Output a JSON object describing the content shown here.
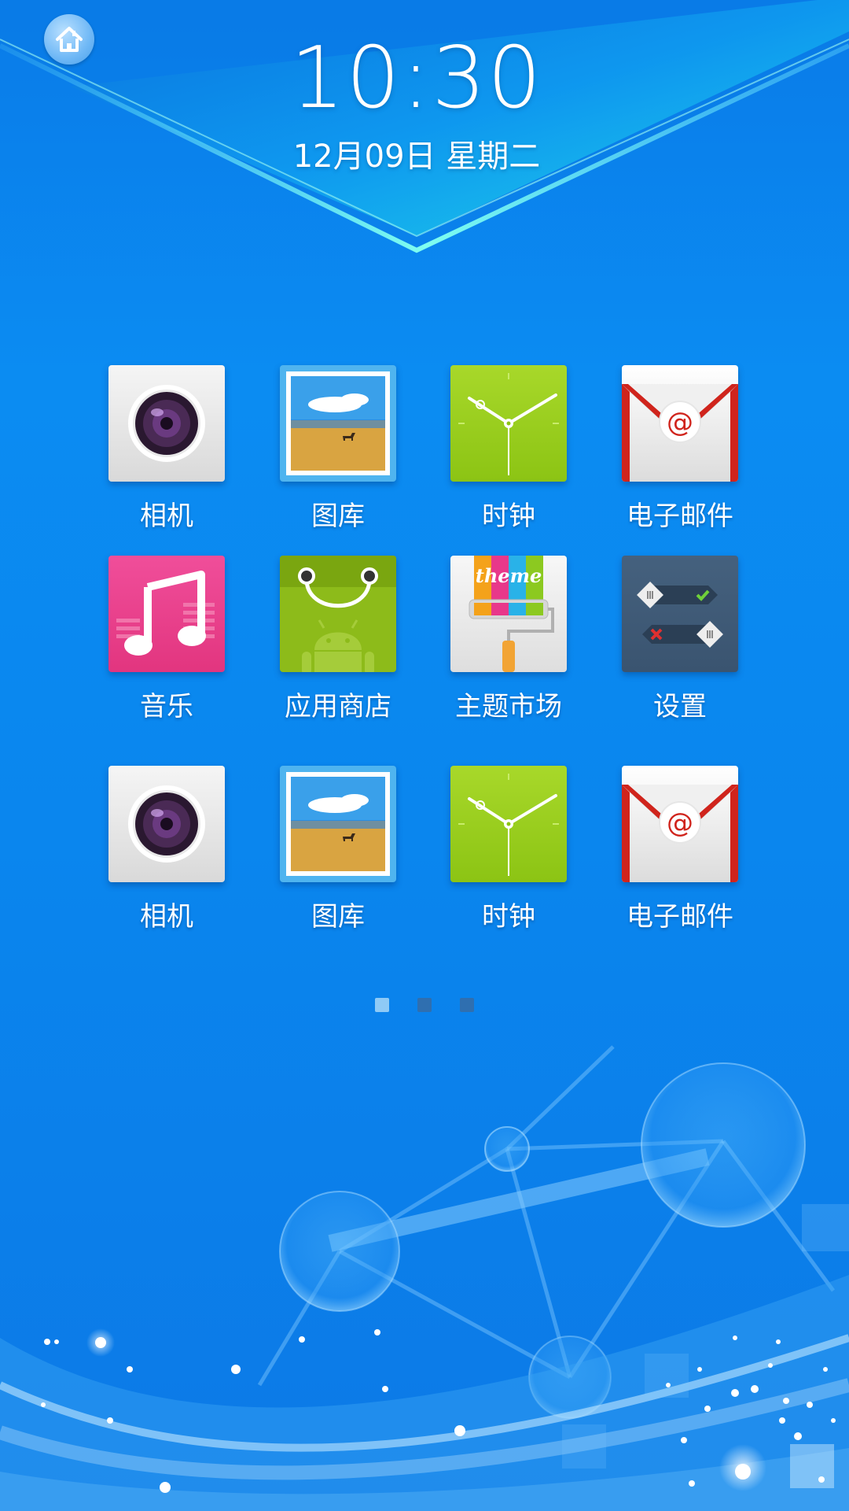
{
  "status": {
    "time": "10:30",
    "date": "12月09日 星期二"
  },
  "home_button": {
    "icon": "home-icon"
  },
  "apps": [
    {
      "label": "相机",
      "icon": "camera-icon"
    },
    {
      "label": "图库",
      "icon": "gallery-icon"
    },
    {
      "label": "时钟",
      "icon": "clock-icon"
    },
    {
      "label": "电子邮件",
      "icon": "email-icon"
    },
    {
      "label": "音乐",
      "icon": "music-icon"
    },
    {
      "label": "应用商店",
      "icon": "app-store-icon"
    },
    {
      "label": "主题市场",
      "icon": "theme-store-icon"
    },
    {
      "label": "设置",
      "icon": "settings-icon"
    },
    {
      "label": "相机",
      "icon": "camera-icon"
    },
    {
      "label": "图库",
      "icon": "gallery-icon"
    },
    {
      "label": "时钟",
      "icon": "clock-icon"
    },
    {
      "label": "电子邮件",
      "icon": "email-icon"
    }
  ],
  "theme_tile_text": "theme",
  "pager": {
    "pages": 3,
    "current": 1
  },
  "colors": {
    "background": "#0a86ee",
    "banner_accent": "#2ef3e6",
    "active_dot": "#8fcaf6"
  }
}
